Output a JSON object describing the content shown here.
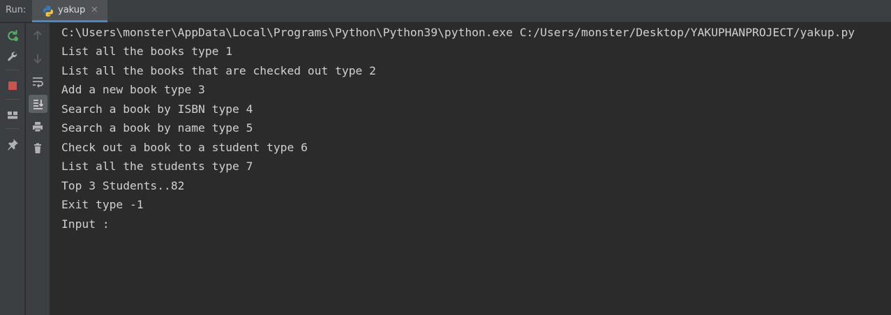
{
  "header": {
    "run_label": "Run:",
    "tab": {
      "label": "yakup",
      "close": "✕"
    }
  },
  "toolbar_left": [
    "rerun-icon",
    "wrench-icon",
    "stop-icon",
    "layout-icon",
    "pin-icon"
  ],
  "toolbar_right": [
    "arrow-up-icon",
    "arrow-down-icon",
    "soft-wrap-icon",
    "scroll-to-end-icon",
    "print-icon",
    "trash-icon"
  ],
  "console": {
    "lines": [
      "C:\\Users\\monster\\AppData\\Local\\Programs\\Python\\Python39\\python.exe C:/Users/monster/Desktop/YAKUPHANPROJECT/yakup.py",
      "List all the books type 1",
      "List all the books that are checked out type 2",
      "Add a new book type 3",
      "Search a book by ISBN type 4",
      "Search a book by name type 5",
      "Check out a book to a student type 6",
      "List all the students type 7",
      "Top 3 Students..82",
      "Exit type -1",
      "Input : "
    ]
  },
  "colors": {
    "background": "#2b2b2b",
    "panel": "#3c3f41",
    "text": "#d0d0d0",
    "tab_active_border": "#4a88c7",
    "rerun_green": "#59a869",
    "stop_red": "#c75450"
  }
}
